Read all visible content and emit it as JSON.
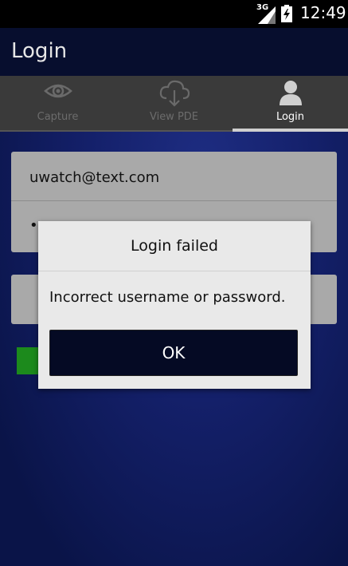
{
  "status_bar": {
    "network_label": "3G",
    "time": "12:49",
    "icons": [
      "signal-icon",
      "battery-charging-icon"
    ]
  },
  "action_bar": {
    "title": "Login"
  },
  "tabs": [
    {
      "label": "Capture",
      "icon": "eye-icon",
      "active": false
    },
    {
      "label": "View PDE",
      "icon": "cloud-download-icon",
      "active": false
    },
    {
      "label": "Login",
      "icon": "user-icon",
      "active": true
    }
  ],
  "form": {
    "email_value": "uwatch@text.com",
    "password_value": "••••••"
  },
  "dialog": {
    "title": "Login failed",
    "message": "Incorrect username or password.",
    "ok_label": "OK"
  },
  "colors": {
    "action_bar_bg": "#070e2e",
    "tab_bar_bg": "#3a3a3a",
    "field_bg": "#a9a9a9",
    "dialog_bg": "#e9e9e9",
    "ok_button_bg": "#050a24",
    "green_accent": "#1c8a1c"
  }
}
